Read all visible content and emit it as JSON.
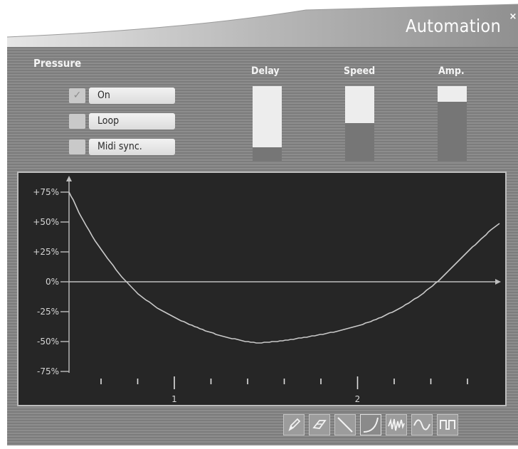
{
  "window": {
    "title": "Automation",
    "close_glyph": "×"
  },
  "section": {
    "title": "Pressure"
  },
  "options": [
    {
      "label": "On",
      "checked": true
    },
    {
      "label": "Loop",
      "checked": false
    },
    {
      "label": "Midi sync.",
      "checked": false
    }
  ],
  "sliders": [
    {
      "label": "Delay",
      "level": 0.18
    },
    {
      "label": "Speed",
      "level": 0.5
    },
    {
      "label": "Amp.",
      "level": 0.79
    }
  ],
  "graph": {
    "y_ticks": [
      "+75%",
      "+50%",
      "+25%",
      "0%",
      "-25%",
      "-50%",
      "-75%"
    ],
    "x_labels": [
      "1",
      "2"
    ],
    "curve_color": "#c9c9c9"
  },
  "toolbar": {
    "tools": [
      {
        "icon": "pencil-icon",
        "active": false
      },
      {
        "icon": "eraser-icon",
        "active": false
      },
      {
        "icon": "line-icon",
        "active": false
      },
      {
        "icon": "curve-icon",
        "active": true
      },
      {
        "icon": "random-wave-icon",
        "active": false
      },
      {
        "icon": "sine-wave-icon",
        "active": false
      },
      {
        "icon": "square-wave-icon",
        "active": false
      }
    ]
  }
}
